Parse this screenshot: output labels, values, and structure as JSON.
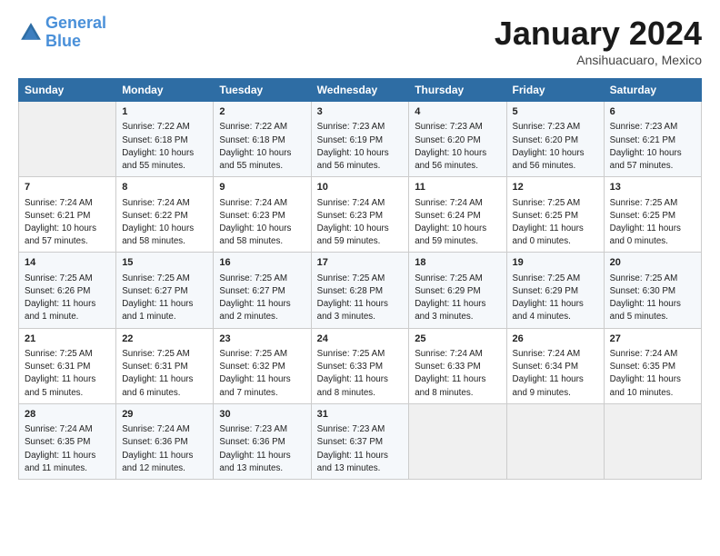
{
  "header": {
    "logo_line1": "General",
    "logo_line2": "Blue",
    "month": "January 2024",
    "location": "Ansihuacuaro, Mexico"
  },
  "days_of_week": [
    "Sunday",
    "Monday",
    "Tuesday",
    "Wednesday",
    "Thursday",
    "Friday",
    "Saturday"
  ],
  "weeks": [
    [
      {
        "day": "",
        "info": ""
      },
      {
        "day": "1",
        "info": "Sunrise: 7:22 AM\nSunset: 6:18 PM\nDaylight: 10 hours\nand 55 minutes."
      },
      {
        "day": "2",
        "info": "Sunrise: 7:22 AM\nSunset: 6:18 PM\nDaylight: 10 hours\nand 55 minutes."
      },
      {
        "day": "3",
        "info": "Sunrise: 7:23 AM\nSunset: 6:19 PM\nDaylight: 10 hours\nand 56 minutes."
      },
      {
        "day": "4",
        "info": "Sunrise: 7:23 AM\nSunset: 6:20 PM\nDaylight: 10 hours\nand 56 minutes."
      },
      {
        "day": "5",
        "info": "Sunrise: 7:23 AM\nSunset: 6:20 PM\nDaylight: 10 hours\nand 56 minutes."
      },
      {
        "day": "6",
        "info": "Sunrise: 7:23 AM\nSunset: 6:21 PM\nDaylight: 10 hours\nand 57 minutes."
      }
    ],
    [
      {
        "day": "7",
        "info": "Sunrise: 7:24 AM\nSunset: 6:21 PM\nDaylight: 10 hours\nand 57 minutes."
      },
      {
        "day": "8",
        "info": "Sunrise: 7:24 AM\nSunset: 6:22 PM\nDaylight: 10 hours\nand 58 minutes."
      },
      {
        "day": "9",
        "info": "Sunrise: 7:24 AM\nSunset: 6:23 PM\nDaylight: 10 hours\nand 58 minutes."
      },
      {
        "day": "10",
        "info": "Sunrise: 7:24 AM\nSunset: 6:23 PM\nDaylight: 10 hours\nand 59 minutes."
      },
      {
        "day": "11",
        "info": "Sunrise: 7:24 AM\nSunset: 6:24 PM\nDaylight: 10 hours\nand 59 minutes."
      },
      {
        "day": "12",
        "info": "Sunrise: 7:25 AM\nSunset: 6:25 PM\nDaylight: 11 hours\nand 0 minutes."
      },
      {
        "day": "13",
        "info": "Sunrise: 7:25 AM\nSunset: 6:25 PM\nDaylight: 11 hours\nand 0 minutes."
      }
    ],
    [
      {
        "day": "14",
        "info": "Sunrise: 7:25 AM\nSunset: 6:26 PM\nDaylight: 11 hours\nand 1 minute."
      },
      {
        "day": "15",
        "info": "Sunrise: 7:25 AM\nSunset: 6:27 PM\nDaylight: 11 hours\nand 1 minute."
      },
      {
        "day": "16",
        "info": "Sunrise: 7:25 AM\nSunset: 6:27 PM\nDaylight: 11 hours\nand 2 minutes."
      },
      {
        "day": "17",
        "info": "Sunrise: 7:25 AM\nSunset: 6:28 PM\nDaylight: 11 hours\nand 3 minutes."
      },
      {
        "day": "18",
        "info": "Sunrise: 7:25 AM\nSunset: 6:29 PM\nDaylight: 11 hours\nand 3 minutes."
      },
      {
        "day": "19",
        "info": "Sunrise: 7:25 AM\nSunset: 6:29 PM\nDaylight: 11 hours\nand 4 minutes."
      },
      {
        "day": "20",
        "info": "Sunrise: 7:25 AM\nSunset: 6:30 PM\nDaylight: 11 hours\nand 5 minutes."
      }
    ],
    [
      {
        "day": "21",
        "info": "Sunrise: 7:25 AM\nSunset: 6:31 PM\nDaylight: 11 hours\nand 5 minutes."
      },
      {
        "day": "22",
        "info": "Sunrise: 7:25 AM\nSunset: 6:31 PM\nDaylight: 11 hours\nand 6 minutes."
      },
      {
        "day": "23",
        "info": "Sunrise: 7:25 AM\nSunset: 6:32 PM\nDaylight: 11 hours\nand 7 minutes."
      },
      {
        "day": "24",
        "info": "Sunrise: 7:25 AM\nSunset: 6:33 PM\nDaylight: 11 hours\nand 8 minutes."
      },
      {
        "day": "25",
        "info": "Sunrise: 7:24 AM\nSunset: 6:33 PM\nDaylight: 11 hours\nand 8 minutes."
      },
      {
        "day": "26",
        "info": "Sunrise: 7:24 AM\nSunset: 6:34 PM\nDaylight: 11 hours\nand 9 minutes."
      },
      {
        "day": "27",
        "info": "Sunrise: 7:24 AM\nSunset: 6:35 PM\nDaylight: 11 hours\nand 10 minutes."
      }
    ],
    [
      {
        "day": "28",
        "info": "Sunrise: 7:24 AM\nSunset: 6:35 PM\nDaylight: 11 hours\nand 11 minutes."
      },
      {
        "day": "29",
        "info": "Sunrise: 7:24 AM\nSunset: 6:36 PM\nDaylight: 11 hours\nand 12 minutes."
      },
      {
        "day": "30",
        "info": "Sunrise: 7:23 AM\nSunset: 6:36 PM\nDaylight: 11 hours\nand 13 minutes."
      },
      {
        "day": "31",
        "info": "Sunrise: 7:23 AM\nSunset: 6:37 PM\nDaylight: 11 hours\nand 13 minutes."
      },
      {
        "day": "",
        "info": ""
      },
      {
        "day": "",
        "info": ""
      },
      {
        "day": "",
        "info": ""
      }
    ]
  ]
}
